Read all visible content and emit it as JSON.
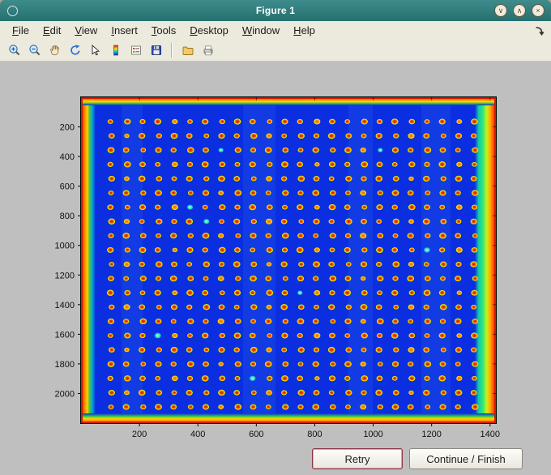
{
  "window": {
    "title": "Figure 1",
    "controls": {
      "shade_glyph": "∨",
      "maximize_glyph": "∧",
      "close_glyph": "×"
    }
  },
  "menubar": {
    "items": [
      "File",
      "Edit",
      "View",
      "Insert",
      "Tools",
      "Desktop",
      "Window",
      "Help"
    ]
  },
  "toolbar": {
    "icons": [
      "zoom-in",
      "zoom-out",
      "pan",
      "rotate-3d",
      "data-cursor",
      "insert-colorbar",
      "insert-legend",
      "save",
      "open",
      "print"
    ]
  },
  "figure": {
    "canvas_color": "#bfbfbf",
    "axes": {
      "xticks": [
        200,
        400,
        600,
        800,
        1000,
        1200,
        1400
      ],
      "yticks": [
        200,
        400,
        600,
        800,
        1000,
        1200,
        1400,
        1600,
        1800,
        2000
      ],
      "xlim": [
        0,
        1420
      ],
      "ylim": [
        0,
        2200
      ],
      "tick_color": "#111111"
    },
    "image": {
      "type": "heatmap",
      "colormap": "jet",
      "description": "microarray plate scan, blue background with grid of red/orange spots and hot edges",
      "base_color": "#0a2ee0",
      "edge_color": "#d81800",
      "spot_rows": 21,
      "spot_cols": 24,
      "anomalous_spots": [
        [
          2,
          7
        ],
        [
          2,
          17
        ],
        [
          6,
          5
        ],
        [
          7,
          6
        ],
        [
          9,
          20
        ],
        [
          12,
          12
        ],
        [
          15,
          3
        ],
        [
          18,
          9
        ]
      ]
    }
  },
  "buttons": {
    "retry": "Retry",
    "continue_finish": "Continue / Finish"
  }
}
